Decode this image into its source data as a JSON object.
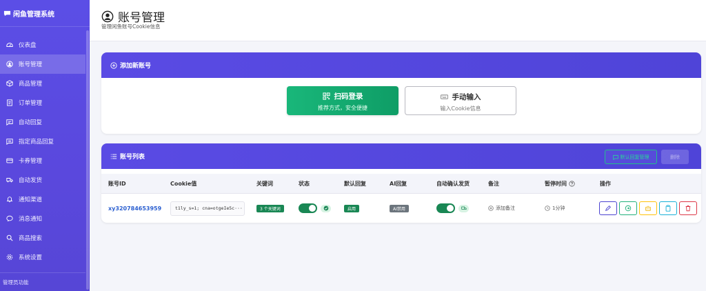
{
  "sidebar": {
    "brand": "闲鱼管理系统",
    "items": [
      {
        "label": "仪表盘",
        "icon": "dashboard-icon"
      },
      {
        "label": "账号管理",
        "icon": "user-circle-icon",
        "active": true
      },
      {
        "label": "商品管理",
        "icon": "box-icon"
      },
      {
        "label": "订单管理",
        "icon": "receipt-icon"
      },
      {
        "label": "自动回复",
        "icon": "chat-icon"
      },
      {
        "label": "指定商品回复",
        "icon": "chat-text-icon"
      },
      {
        "label": "卡券管理",
        "icon": "card-icon"
      },
      {
        "label": "自动发货",
        "icon": "truck-icon"
      },
      {
        "label": "通知渠道",
        "icon": "bell-icon"
      },
      {
        "label": "消息通知",
        "icon": "message-icon"
      },
      {
        "label": "商品搜索",
        "icon": "search-icon"
      },
      {
        "label": "系统设置",
        "icon": "gear-icon"
      }
    ],
    "footer": "管理员功能"
  },
  "header": {
    "title": "账号管理",
    "subtitle": "管理闲鱼账号Cookie信息"
  },
  "add_card": {
    "title": "添加新账号",
    "qr_button": {
      "label": "扫码登录",
      "sub": "推荐方式，安全便捷"
    },
    "manual_button": {
      "label": "手动输入",
      "sub": "输入Cookie信息"
    }
  },
  "list_card": {
    "title": "账号列表",
    "default_reply_button": "默认回复管理",
    "delete_button": "删除",
    "columns": {
      "id": "账号ID",
      "cookie": "Cookie值",
      "keywords": "关键词",
      "status": "状态",
      "default_reply": "默认回复",
      "ai_reply": "AI回复",
      "auto_confirm": "自动确认发货",
      "note": "备注",
      "pause_time": "暂停时间",
      "actions": "操作"
    },
    "rows": [
      {
        "id": "xy320784653959",
        "cookie": "t1ly_s=1; cna=otgeIe5c···",
        "keywords": "3 个关键词",
        "status_enabled": true,
        "default_reply": "启用",
        "ai_reply": "AI禁用",
        "auto_confirm_enabled": true,
        "note": "添加备注",
        "pause_time": "1分钟"
      }
    ]
  },
  "colors": {
    "sidebar": "#5a4be4",
    "primary": "#4f44d8",
    "success": "#198754",
    "link": "#2b5fd0"
  }
}
